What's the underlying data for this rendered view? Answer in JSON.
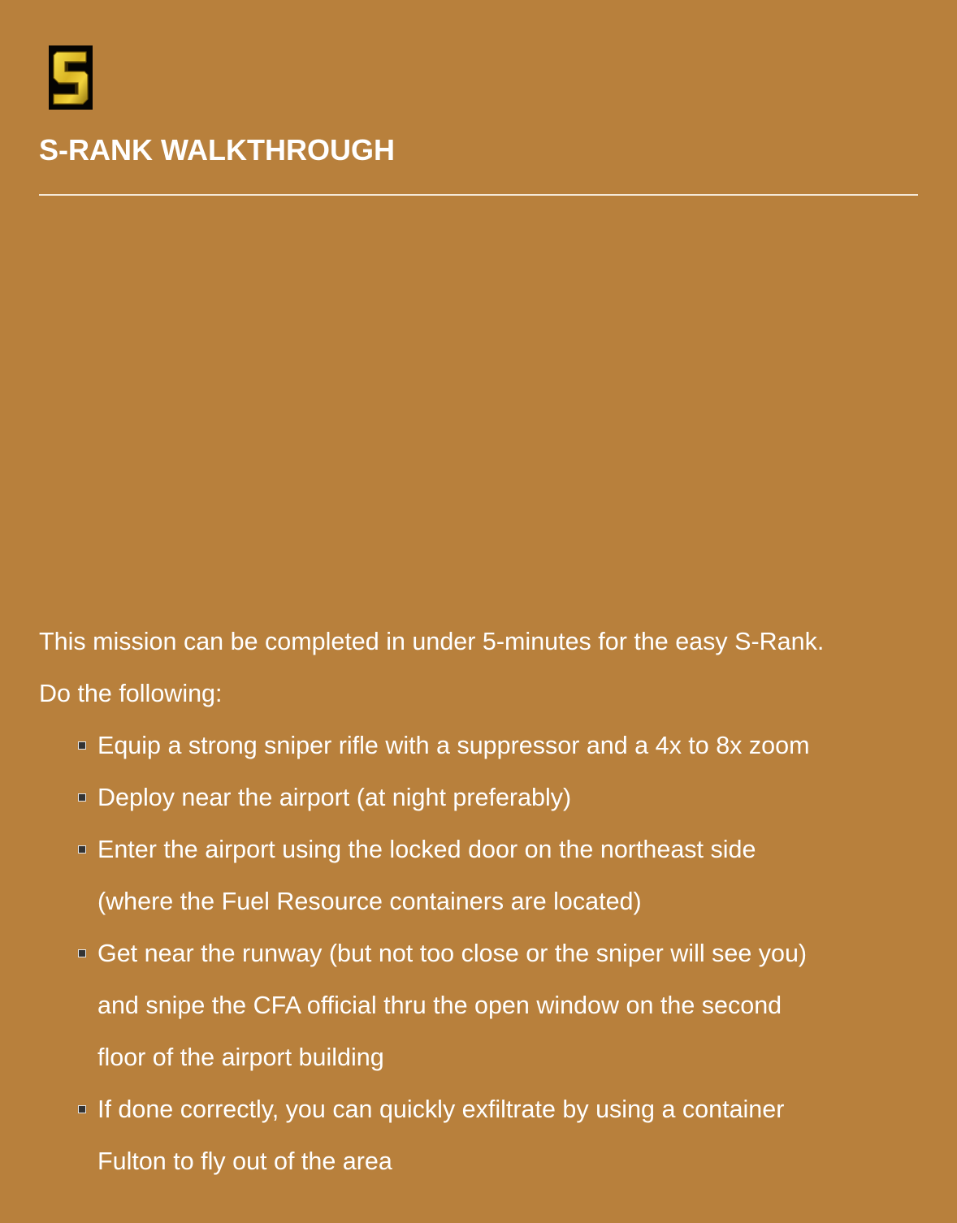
{
  "badge": {
    "icon": "s-rank-icon",
    "letter": "S",
    "colors": {
      "background": "#050402",
      "gold_light": "#f2d33c",
      "gold_dark": "#9a7a10"
    }
  },
  "header": {
    "title": "S-RANK WALKTHROUGH"
  },
  "content": {
    "intro": "This mission can be completed in under 5-minutes for the easy S-Rank.",
    "lead": "Do the following:",
    "steps": [
      {
        "lines": [
          "Equip a strong sniper rifle with a suppressor and a 4x to 8x zoom"
        ]
      },
      {
        "lines": [
          "Deploy near the airport (at night preferably)"
        ]
      },
      {
        "lines": [
          "Enter the airport using the locked door on the northeast side",
          "(where the Fuel Resource containers are located)"
        ]
      },
      {
        "lines": [
          "Get near the runway (but not too close or the sniper will see you)",
          "and snipe the CFA official thru the open window on the second",
          "floor of the airport building"
        ]
      },
      {
        "lines": [
          "If done correctly, you can quickly exfiltrate by using a container",
          "Fulton to fly out of the area"
        ]
      }
    ]
  },
  "colors": {
    "page_background": "#b8803c",
    "text": "#ffffff",
    "divider": "#f5e9d8"
  }
}
